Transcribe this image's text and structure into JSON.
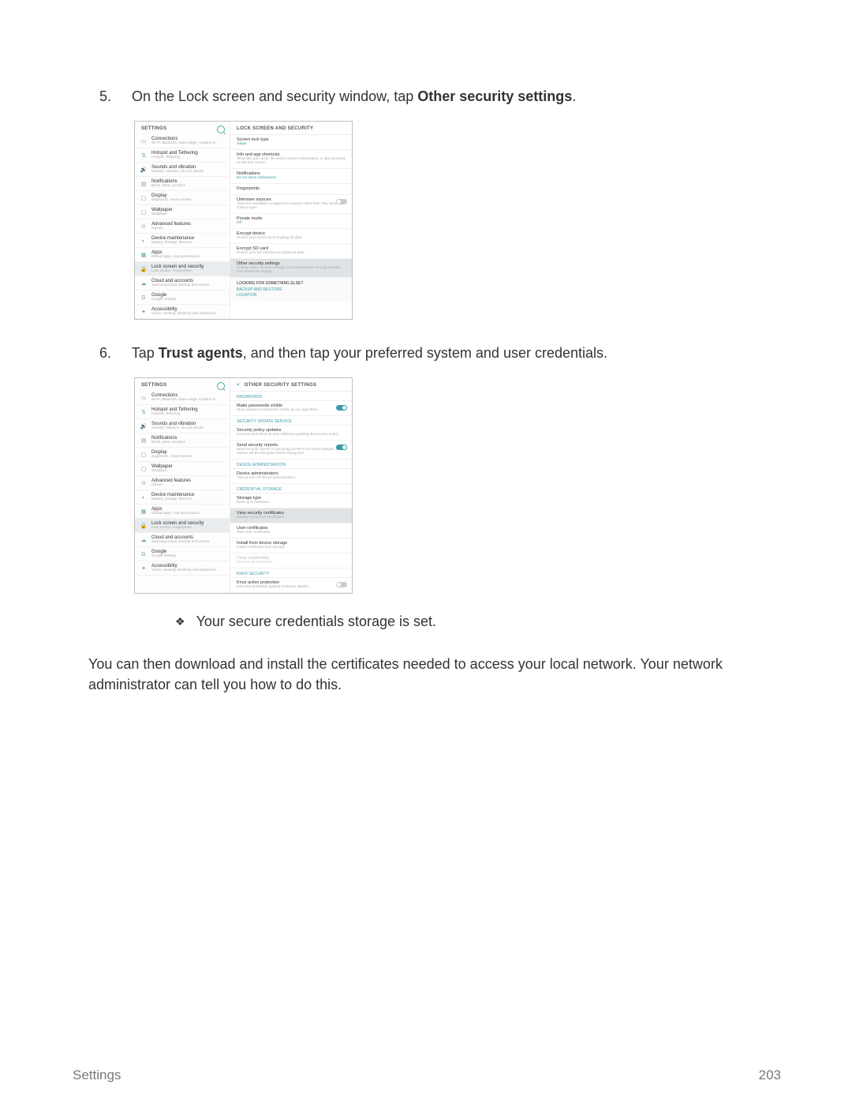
{
  "step5": {
    "num": "5.",
    "pre": "On the Lock screen and security window, tap ",
    "bold": "Other security settings",
    "post": "."
  },
  "step6": {
    "num": "6.",
    "pre": "Tap ",
    "bold": "Trust agents",
    "post": ", and then tap your preferred system and user credentials."
  },
  "bullet": "Your secure credentials storage is set.",
  "para": "You can then download and install the certificates needed to access your local network. Your network administrator can tell you how to do this.",
  "footer": {
    "left": "Settings",
    "right": "203"
  },
  "sidebar": {
    "title": "SETTINGS",
    "items": [
      {
        "ico": "▭",
        "label": "Connections",
        "sub": "Wi-Fi, Bluetooth, Data usage, Airplane m..."
      },
      {
        "ico": "⇅",
        "label": "Hotspot and Tethering",
        "sub": "Hotspot, Tethering"
      },
      {
        "ico": "🔊",
        "label": "Sounds and vibration",
        "sub": "Sounds, Vibration, Do not disturb"
      },
      {
        "ico": "▤",
        "label": "Notifications",
        "sub": "Block, allow, prioritize"
      },
      {
        "ico": "▢",
        "label": "Display",
        "sub": "Brightness, Home screen"
      },
      {
        "ico": "▢",
        "label": "Wallpaper",
        "sub": "Wallpaper"
      },
      {
        "ico": "⊙",
        "label": "Advanced features",
        "sub": "Games"
      },
      {
        "ico": "◐",
        "label": "Device maintenance",
        "sub": "Battery, Storage, Memory"
      },
      {
        "ico": "▦",
        "label": "Apps",
        "sub": "Default apps, App permissions"
      },
      {
        "ico": "🔒",
        "label": "Lock screen and security",
        "sub": "Lock screen, Fingerprints"
      },
      {
        "ico": "☁",
        "label": "Cloud and accounts",
        "sub": "Samsung Cloud, Backup and restore"
      },
      {
        "ico": "G",
        "label": "Google",
        "sub": "Google settings"
      },
      {
        "ico": "✦",
        "label": "Accessibility",
        "sub": "Vision, Hearing, Dexterity and interaction"
      }
    ]
  },
  "shot1": {
    "title": "LOCK SCREEN AND SECURITY",
    "items": [
      {
        "label": "Screen lock type",
        "sub": "Swipe",
        "link": true
      },
      {
        "label": "Info and app shortcuts",
        "sub": "Show the dual clock, the device owner's information, or app shortcuts on the lock screen."
      },
      {
        "label": "Notifications",
        "sub": "Do not show notifications",
        "link": true
      },
      {
        "label": "Fingerprints"
      },
      {
        "label": "Unknown sources",
        "sub": "Allow the installation of apps from sources other than Play Store or Galaxy Apps.",
        "toggle": "off"
      },
      {
        "label": "Private mode",
        "sub": "Off",
        "link": true
      },
      {
        "label": "Encrypt device",
        "sub": "Protect your device by encrypting its data."
      },
      {
        "label": "Encrypt SD card",
        "sub": "Protect your SD card by encrypting its data."
      },
      {
        "label": "Other security settings",
        "sub": "Change other security settings, such as those for security updates and credential storage.",
        "sel": true
      }
    ],
    "looking": {
      "hd": "LOOKING FOR SOMETHING ELSE?",
      "a": "BACKUP AND RESTORE",
      "b": "LOCATION"
    }
  },
  "shot2": {
    "title": "OTHER SECURITY SETTINGS",
    "sections": [
      {
        "hd": "PASSWORDS",
        "items": [
          {
            "label": "Make passwords visible",
            "sub": "Show password characters briefly as you type them.",
            "toggle": "on"
          }
        ]
      },
      {
        "hd": "SECURITY UPDATE SERVICE",
        "items": [
          {
            "label": "Security policy updates",
            "sub": "Increase protection on your tablet by updating the security policy."
          },
          {
            "label": "Send security reports",
            "sub": "Send security reports to Samsung via Wi-Fi for threat analysis. All reports will be encrypted before being sent.",
            "toggle": "on"
          }
        ]
      },
      {
        "hd": "DEVICE ADMINISTRATION",
        "items": [
          {
            "label": "Device administrators",
            "sub": "View or turn off device administrators."
          }
        ]
      },
      {
        "hd": "CREDENTIAL STORAGE",
        "items": [
          {
            "label": "Storage type",
            "sub": "Back up to hardware."
          },
          {
            "label": "View security certificates",
            "sub": "Display trusted CA certificates.",
            "sel": true
          },
          {
            "label": "User certificates",
            "sub": "View user certificates."
          },
          {
            "label": "Install from device storage",
            "sub": "Install certificates from storage."
          },
          {
            "label": "Clear credentials",
            "sub": "Remove all certificates.",
            "disabled": true
          }
        ]
      },
      {
        "hd": "KNOX SECURITY",
        "items": [
          {
            "label": "Knox active protection",
            "sub": "Get extra protection against malicious attacks.",
            "toggle": "off"
          }
        ]
      }
    ]
  }
}
